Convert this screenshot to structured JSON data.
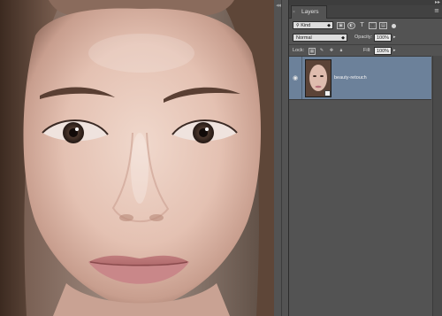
{
  "canvas": {
    "image": "portrait-photo"
  },
  "layers_panel": {
    "tab_label": "Layers",
    "tab_close_icon": "close-icon",
    "menu_icon": "panel-menu-icon",
    "filter": {
      "kind_value": "Kind",
      "kind_prefix_icon": "search-icon",
      "icons": [
        "image-filter-icon",
        "adjustment-filter-icon",
        "type-filter-icon",
        "shape-filter-icon",
        "smart-object-filter-icon"
      ]
    },
    "blend_mode": "Normal",
    "opacity_label": "Opacity:",
    "opacity_value": "100%",
    "lock_label": "Lock:",
    "fill_label": "Fill:",
    "fill_value": "100%",
    "layers": [
      {
        "name": "beauty-retouch",
        "visible": true,
        "selected": true,
        "smart_object": true
      }
    ],
    "selection_color": "#6c819a"
  }
}
